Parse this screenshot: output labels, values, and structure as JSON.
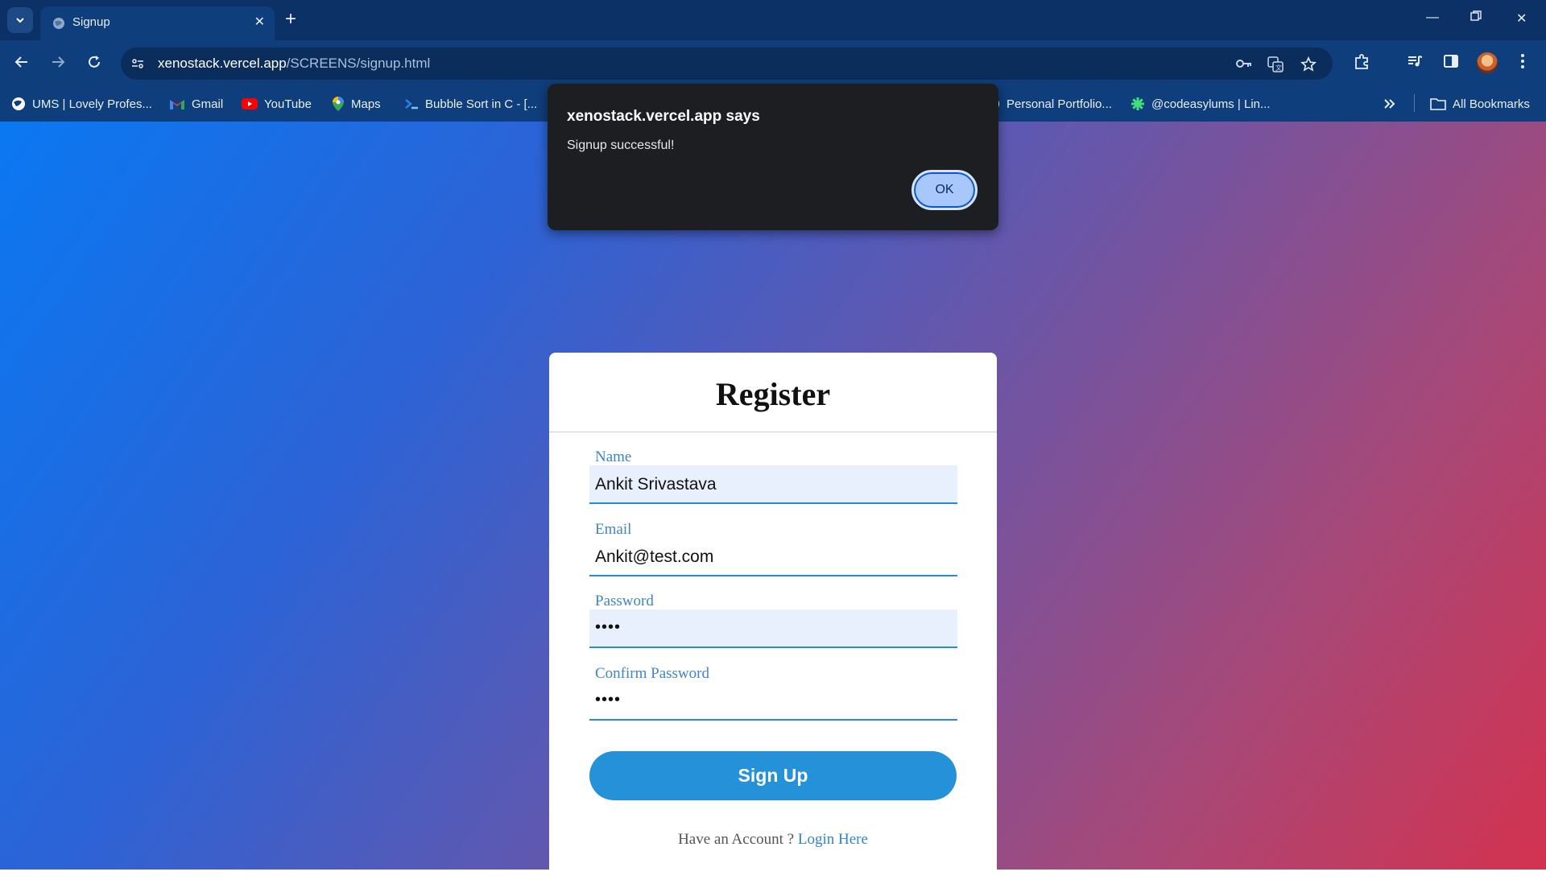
{
  "browser": {
    "tab": {
      "title": "Signup",
      "favicon": "globe-icon"
    },
    "address_bar": {
      "host": "xenostack.vercel.app",
      "path": "/SCREENS/signup.html"
    },
    "bookmarks": [
      {
        "label": "UMS | Lovely Profes...",
        "icon": "globe-icon"
      },
      {
        "label": "Gmail",
        "icon": "gmail-icon"
      },
      {
        "label": "YouTube",
        "icon": "youtube-icon"
      },
      {
        "label": "Maps",
        "icon": "maps-icon"
      },
      {
        "label": "Bubble Sort in C - [...",
        "icon": "code-icon"
      },
      {
        "label": "Personal Portfolio...",
        "icon": "portfolio-icon"
      },
      {
        "label": "@codeasylums | Lin...",
        "icon": "asterisk-icon"
      }
    ],
    "all_bookmarks_label": "All Bookmarks"
  },
  "dialog": {
    "title": "xenostack.vercel.app says",
    "message": "Signup successful!",
    "ok_label": "OK"
  },
  "form": {
    "heading": "Register",
    "fields": [
      {
        "label": "Name",
        "value": "Ankit Srivastava"
      },
      {
        "label": "Email",
        "value": "Ankit@test.com"
      },
      {
        "label": "Password",
        "value": "••••"
      },
      {
        "label": "Confirm Password",
        "value": "••••"
      }
    ],
    "submit_label": "Sign Up",
    "login_prompt": "Have an Account ?",
    "login_link": "Login Here"
  },
  "colors": {
    "accent": "#2591d9",
    "gradient_start": "#0a78f2",
    "gradient_end": "#d3324f"
  }
}
